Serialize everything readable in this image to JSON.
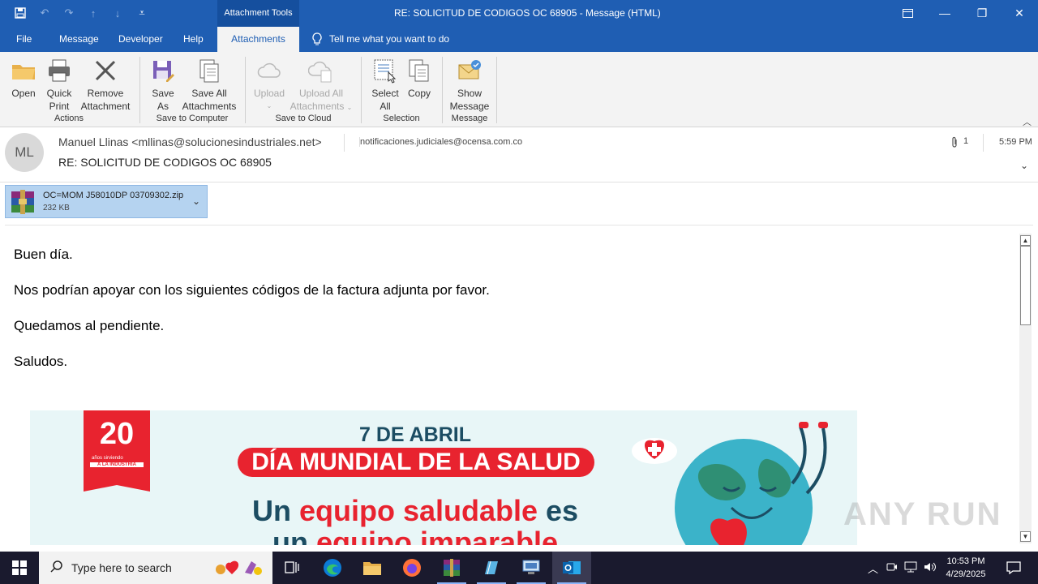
{
  "window": {
    "title": "RE: SOLICITUD DE CODIGOS OC 68905  -  Message (HTML)",
    "context_tools": "Attachment Tools"
  },
  "tabs": [
    "File",
    "Message",
    "Developer",
    "Help"
  ],
  "active_tab": "Attachments",
  "tell_me": "Tell me what you want to do",
  "ribbon": {
    "open": "Open",
    "quick_print_1": "Quick",
    "quick_print_2": "Print",
    "remove_1": "Remove",
    "remove_2": "Attachment",
    "actions": "Actions",
    "save_as_1": "Save",
    "save_as_2": "As",
    "save_all_1": "Save All",
    "save_all_2": "Attachments",
    "save_to_computer": "Save to Computer",
    "upload": "Upload",
    "upload_all_1": "Upload All",
    "upload_all_2": "Attachments",
    "save_to_cloud": "Save to Cloud",
    "select_all_1": "Select",
    "select_all_2": "All",
    "copy": "Copy",
    "selection": "Selection",
    "show_message_1": "Show",
    "show_message_2": "Message",
    "message": "Message"
  },
  "email": {
    "avatar": "ML",
    "from": "Manuel Llinas <mllinas@solucionesindustriales.net>",
    "to": "notificaciones.judiciales@ocensa.com.co",
    "subject": "RE: SOLICITUD DE CODIGOS OC 68905",
    "attachment_count": "1",
    "time": "5:59 PM",
    "attachment_name": "OC=MOM J58010DP 03709302.zip",
    "attachment_size": "232 KB",
    "body": [
      "Buen día.",
      "Nos podrían apoyar con los siguientes códigos de la factura adjunta por favor.",
      "Quedamos al pendiente.",
      "Saludos."
    ]
  },
  "banner": {
    "badge_number": "20",
    "badge_small": "años sirviendo",
    "badge_tag": "A LA INDUSTRIA",
    "date": "7 DE ABRIL",
    "headline": "DÍA MUNDIAL DE LA SALUD",
    "line1_a": "Un ",
    "line1_b": "equipo saludable",
    "line1_c": " es",
    "line2_a": "un ",
    "line2_b": "equipo imparable"
  },
  "taskbar": {
    "search_placeholder": "Type here to search",
    "time": "10:53 PM",
    "date": "4/29/2025"
  },
  "watermark": "ANY RUN",
  "colors": {
    "ribbon_blue": "#1f5eb3",
    "attachment_bg": "#b5d3f0",
    "banner_red": "#e8232f",
    "banner_navy": "#1c4d63"
  }
}
